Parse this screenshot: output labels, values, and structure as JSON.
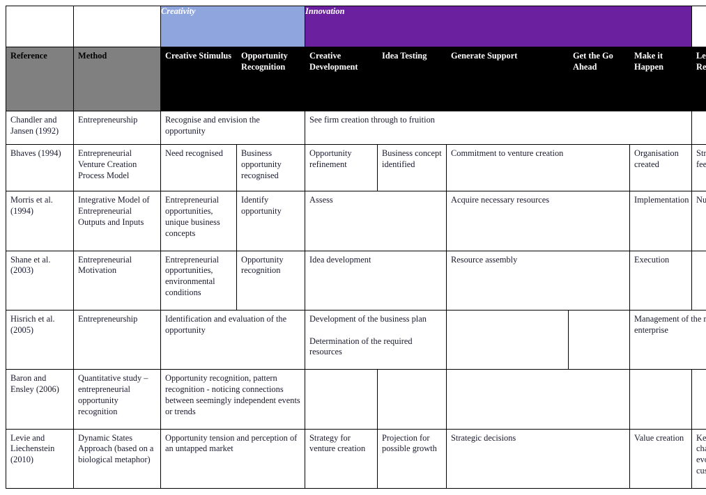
{
  "table": {
    "bands": [
      {
        "label": "",
        "colspan": 1,
        "style": "blank"
      },
      {
        "label": "",
        "colspan": 1,
        "style": "blank"
      },
      {
        "label": "Creativity",
        "colspan": 2,
        "style": "creativity"
      },
      {
        "label": "Innovation",
        "colspan": 5,
        "style": "innovation"
      },
      {
        "label": "",
        "colspan": 1,
        "style": "blank"
      }
    ],
    "columns": [
      "Reference",
      "Method",
      "Creative Stimulus",
      "Opportunity Recognition",
      "Creative Development",
      "Idea Testing",
      "Generate Support",
      "Get the Go Ahead",
      "Make it Happen",
      "Learn from the Results"
    ],
    "rows": [
      {
        "reference": "Chandler and Jansen (1992)",
        "method": "Entrepreneurship",
        "cells": [
          {
            "text": "Recognise and envision the opportunity",
            "colspan": 2
          },
          {
            "text": "See firm creation through to fruition",
            "colspan": 5
          },
          {
            "text": "",
            "colspan": 1
          }
        ]
      },
      {
        "reference": "Bhaves (1994)",
        "method": "Entrepreneurial Venture Creation Process Model",
        "cells": [
          {
            "text": "Need recognised",
            "colspan": 1
          },
          {
            "text": "Business opportunity recognised",
            "colspan": 1
          },
          {
            "text": "Opportunity refinement",
            "colspan": 1
          },
          {
            "text": "Business concept identified",
            "colspan": 1
          },
          {
            "text": "Commitment to venture creation",
            "colspan": 2
          },
          {
            "text": "Organisation created",
            "colspan": 1
          },
          {
            "text": "Strategic feedback loop",
            "colspan": 1
          }
        ]
      },
      {
        "reference": "Morris et al. (1994)",
        "method": "Integrative Model of Entrepreneurial Outputs and Inputs",
        "cells": [
          {
            "text": "Entrepreneurial opportunities, unique business concepts",
            "colspan": 1
          },
          {
            "text": "Identify opportunity",
            "colspan": 1
          },
          {
            "text": "Assess",
            "colspan": 2
          },
          {
            "text": "Acquire necessary resources",
            "colspan": 2
          },
          {
            "text": "Implementation",
            "colspan": 1
          },
          {
            "text": "Number of events",
            "colspan": 1
          }
        ]
      },
      {
        "reference": "Shane et al. (2003)",
        "method": "Entrepreneurial Motivation",
        "cells": [
          {
            "text": "Entrepreneurial opportunities, environmental conditions",
            "colspan": 1
          },
          {
            "text": "Opportunity recognition",
            "colspan": 1
          },
          {
            "text": "Idea development",
            "colspan": 2
          },
          {
            "text": "Resource assembly",
            "colspan": 2
          },
          {
            "text": "Execution",
            "colspan": 1
          },
          {
            "text": "",
            "colspan": 1
          }
        ]
      },
      {
        "reference": "Hisrich et al. (2005)",
        "method": "Entrepreneurship",
        "cells": [
          {
            "text": "Identification and evaluation of the opportunity",
            "colspan": 2
          },
          {
            "paras": [
              "Development of the business plan",
              "Determination of the required resources"
            ],
            "colspan": 2
          },
          {
            "text": "",
            "colspan": 1
          },
          {
            "text": "",
            "colspan": 1
          },
          {
            "text": "Management of the resulting enterprise",
            "colspan": 2
          }
        ]
      },
      {
        "reference": "Baron and Ensley (2006)",
        "method": "Quantitative study – entrepreneurial opportunity recognition",
        "cells": [
          {
            "text": "Opportunity recognition, pattern recognition -  noticing connections between seemingly independent events or trends",
            "colspan": 2
          },
          {
            "text": "",
            "colspan": 1
          },
          {
            "text": "",
            "colspan": 1
          },
          {
            "text": "",
            "colspan": 2
          },
          {
            "text": "",
            "colspan": 1
          },
          {
            "text": "",
            "colspan": 1
          }
        ]
      },
      {
        "reference": "Levie and Liechenstein (2010)",
        "method": "Dynamic States Approach (based on a biological metaphor)",
        "cells": [
          {
            "text": "Opportunity tension and perception of an untapped market",
            "colspan": 2
          },
          {
            "text": "Strategy for venture creation",
            "colspan": 1
          },
          {
            "text": "Projection for possible growth",
            "colspan": 1
          },
          {
            "text": "Strategic decisions",
            "colspan": 2
          },
          {
            "text": "Value creation",
            "colspan": 1
          },
          {
            "text": "Keep up with changes and evolving needs of customers",
            "colspan": 1
          }
        ]
      }
    ]
  },
  "colors": {
    "creativity_band": "#8EA5DE",
    "innovation_band": "#6B219F",
    "header_left": "#808080",
    "header_right": "#000000",
    "border": "#000000",
    "text": "#1a1a2e"
  }
}
